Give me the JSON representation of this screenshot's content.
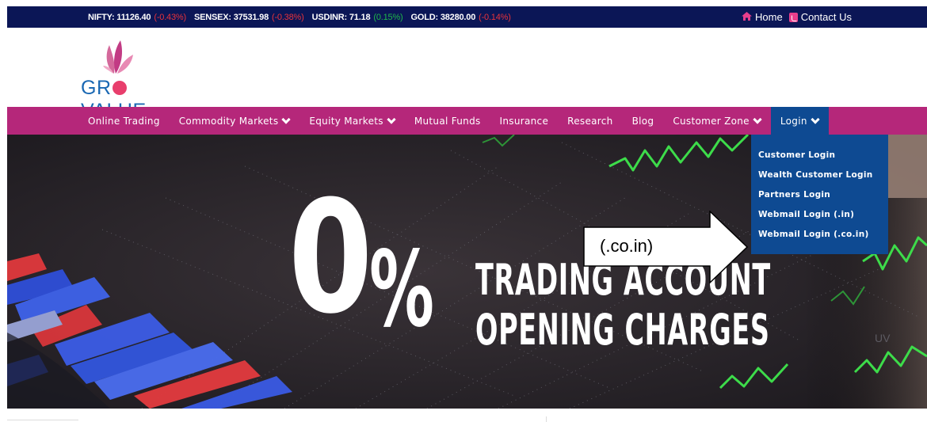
{
  "ticker": [
    {
      "label": "NIFTY: 11126.40",
      "change": "(-0.43%)",
      "change_color": "#e8333b"
    },
    {
      "label": "SENSEX: 37531.98",
      "change": "(-0.38%)",
      "change_color": "#e8333b"
    },
    {
      "label": "USDINR: 71.18",
      "change": "(0.15%)",
      "change_color": "#1fb84a"
    },
    {
      "label": "GOLD: 38280.00",
      "change": "(-0.14%)",
      "change_color": "#e8333b"
    }
  ],
  "top_links": {
    "home": {
      "label": "Home",
      "icon": "home-icon"
    },
    "contact": {
      "label": "Contact Us",
      "icon": "phone-icon"
    }
  },
  "logo": {
    "text_before": "GR",
    "text_after": "VALUE"
  },
  "nav": {
    "items": [
      {
        "label": "Online Trading",
        "dropdown": false
      },
      {
        "label": "Commodity Markets",
        "dropdown": true
      },
      {
        "label": "Equity Markets",
        "dropdown": true
      },
      {
        "label": "Mutual Funds",
        "dropdown": false
      },
      {
        "label": "Insurance",
        "dropdown": false
      },
      {
        "label": "Research",
        "dropdown": false
      },
      {
        "label": "Blog",
        "dropdown": false
      },
      {
        "label": "Customer Zone",
        "dropdown": true
      },
      {
        "label": "Login",
        "dropdown": true,
        "active": true
      }
    ]
  },
  "login_menu": {
    "items": [
      "Customer Login",
      "Wealth Customer Login",
      "Partners Login",
      "Webmail Login (.in)",
      "Webmail Login (.co.in)"
    ]
  },
  "hero": {
    "big_number": "0",
    "percent": "%",
    "line1": "TRADING ACCOUNT",
    "line2": "OPENING CHARGES"
  },
  "callout": {
    "text": "(.co.in)"
  },
  "colors": {
    "ticker_bg": "#0b1656",
    "nav_bg": "#b5277a",
    "nav_active_bg": "#0e4a92",
    "accent_pink": "#e83e8c",
    "logo_blue": "#1a68b3"
  }
}
